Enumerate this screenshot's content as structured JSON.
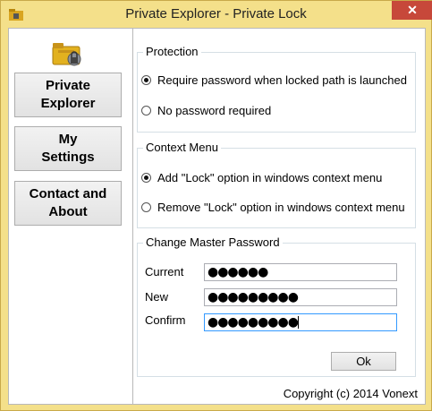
{
  "window": {
    "title": "Private Explorer - Private Lock",
    "close_glyph": "✕",
    "accent": "#f4e08a",
    "close_color": "#c7483a"
  },
  "sidebar": {
    "logo_icon": "folder-lock-icon",
    "items": [
      {
        "label": "Private\nExplorer"
      },
      {
        "label": "My\nSettings"
      },
      {
        "label": "Contact and\nAbout"
      }
    ]
  },
  "protection": {
    "legend": "Protection",
    "options": [
      {
        "label": "Require password when locked path is launched",
        "selected": true
      },
      {
        "label": "No password required",
        "selected": false
      }
    ]
  },
  "context_menu": {
    "legend": "Context Menu",
    "options": [
      {
        "label": "Add \"Lock\" option in windows context menu",
        "selected": true
      },
      {
        "label": "Remove \"Lock\" option in windows context menu",
        "selected": false
      }
    ]
  },
  "master_password": {
    "legend": "Change Master Password",
    "current_label": "Current",
    "current_value": "●●●●●●",
    "new_label": "New",
    "new_value": "●●●●●●●●●",
    "confirm_label": "Confirm",
    "confirm_value": "●●●●●●●●●",
    "ok_label": "Ok"
  },
  "footer": {
    "copyright": "Copyright (c) 2014 Vonext"
  }
}
